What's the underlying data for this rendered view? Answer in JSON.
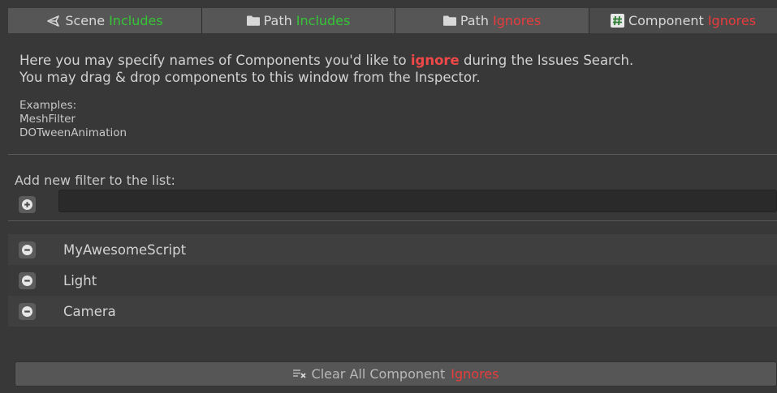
{
  "tabs": [
    {
      "icon": "scene-icon",
      "label": "Scene",
      "accent": "Includes",
      "accent_color": "#36c536"
    },
    {
      "icon": "folder-icon",
      "label": "Path",
      "accent": "Includes",
      "accent_color": "#36c536"
    },
    {
      "icon": "folder-icon",
      "label": "Path",
      "accent": "Ignores",
      "accent_color": "#e83c3c"
    },
    {
      "icon": "script-hash-icon",
      "label": "Component",
      "accent": "Ignores",
      "accent_color": "#e83c3c",
      "active": true
    }
  ],
  "intro": {
    "line1_before": "Here you may specify names of Components you'd like to ",
    "line1_highlight": "ignore",
    "line1_after": " during the Issues Search.",
    "line2": "You may drag & drop components to this window from the Inspector."
  },
  "examples": {
    "title": "Examples:",
    "items": [
      "MeshFilter",
      "DOTweenAnimation"
    ]
  },
  "add_filter": {
    "label": "Add new filter to the list:",
    "input_value": "",
    "input_placeholder": ""
  },
  "ignores": [
    {
      "name": "MyAwesomeScript"
    },
    {
      "name": "Light"
    },
    {
      "name": "Camera"
    }
  ],
  "clear_button": {
    "icon": "clear-list-icon",
    "label": "Clear All Component",
    "accent": "Ignores"
  },
  "colors": {
    "include_green": "#36c536",
    "ignore_red": "#e83c3c",
    "background": "#383838"
  }
}
